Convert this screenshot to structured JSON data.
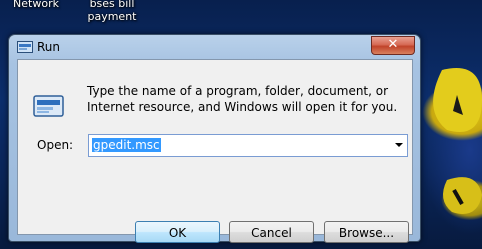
{
  "desktop": {
    "icons": [
      {
        "label": "Network"
      },
      {
        "label_line1": "bses bill",
        "label_line2": "payment"
      }
    ]
  },
  "dialog": {
    "title": "Run",
    "close_symbol": "✕",
    "description": "Type the name of a program, folder, document, or Internet resource, and Windows will open it for you.",
    "open_label": "Open:",
    "open_value": "gpedit.msc",
    "buttons": {
      "ok": "OK",
      "cancel": "Cancel",
      "browse": "Browse..."
    }
  },
  "icons": [
    "run-icon",
    "close-icon",
    "dropdown-arrow-icon"
  ]
}
